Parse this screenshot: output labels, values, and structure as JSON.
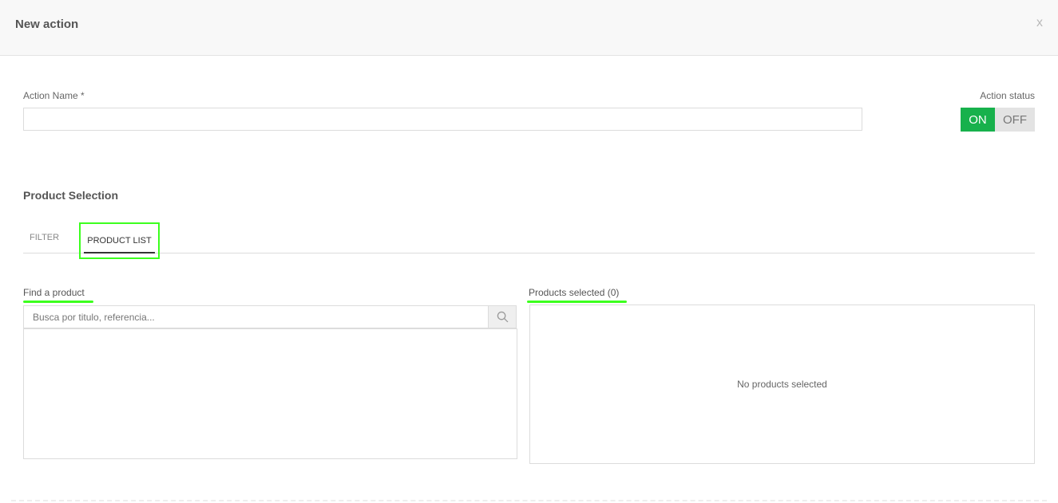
{
  "header": {
    "title": "New action",
    "close_label": "x"
  },
  "form": {
    "action_name_label": "Action Name *",
    "action_name_value": "",
    "status_label": "Action status",
    "status_on_label": "ON",
    "status_off_label": "OFF",
    "status_value": "ON"
  },
  "product_selection": {
    "title": "Product Selection",
    "tabs": [
      {
        "label": "FILTER",
        "active": false
      },
      {
        "label": "PRODUCT LIST",
        "active": true
      }
    ],
    "find": {
      "label": "Find a product",
      "placeholder": "Busca por titulo, referencia..."
    },
    "selected": {
      "label": "Products selected (0)",
      "empty_text": "No products selected"
    }
  },
  "colors": {
    "accent_on": "#17b14c",
    "highlight": "#3cff1e"
  },
  "icons": {
    "search": "search-icon"
  }
}
